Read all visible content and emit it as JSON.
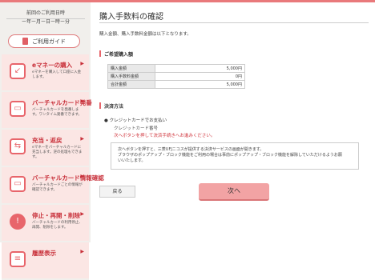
{
  "sidebar": {
    "last_use_label": "前回のご利用日時",
    "last_use_value": "ー年ー月ー日ー時ー分",
    "guide_label": "ご利用ガイド",
    "items": [
      {
        "icon": "emoney-charge-icon",
        "title": "eマネーの購入",
        "arrow": "▶",
        "desc": "eマネーを購入して口座に入金します。"
      },
      {
        "icon": "card-issue-icon",
        "title": "バーチャルカード発番",
        "arrow": "▶",
        "desc": "バーチャルカードを発番します。ワンタイム発番できます。"
      },
      {
        "icon": "charge-refund-icon",
        "title": "充当・返戻",
        "arrow": "▶",
        "desc": "eマネーをバーチャルカードに充当します。逆の処理もできます。"
      },
      {
        "icon": "card-info-icon",
        "title": "バーチャルカード情報確認",
        "arrow": "▶",
        "desc": "バーチャルカードごとの情報が確認できます。"
      },
      {
        "icon": "stop-resume-icon",
        "title": "停止・再開・削除",
        "arrow": "▶",
        "desc": "バーチャルカードの利用停止、再開、削除をします。"
      },
      {
        "icon": "history-icon",
        "title": "履歴表示",
        "arrow": "▶",
        "desc": ""
      }
    ]
  },
  "main": {
    "title": "購入手数料の確認",
    "intro": "購入金額、購入手数料金額は以下となります。",
    "order_section": "ご希望購入額",
    "table": [
      {
        "label": "購入金額",
        "value": "5,000円"
      },
      {
        "label": "購入手数料金額",
        "value": "0円"
      },
      {
        "label": "合計金額",
        "value": "5,000円"
      }
    ],
    "payment_section": "決済方法",
    "payment_method": "クレジットカードでお支払い",
    "payment_sub": "クレジットカード番号",
    "payment_warning": "次へボタンを押して決済手続きへお進みください。",
    "notice_line1": "次へボタンを押すと、三菱UFJニコスが提供する決済サービスの画面が開きます。",
    "notice_line2": "ブラウザのポップアップ・ブロック機能をご利用の場合は事前にポップアップ・ブロック機能を解除していただけるようお願",
    "notice_line3": "いいたします。",
    "back_label": "戻る",
    "next_label": "次へ"
  }
}
